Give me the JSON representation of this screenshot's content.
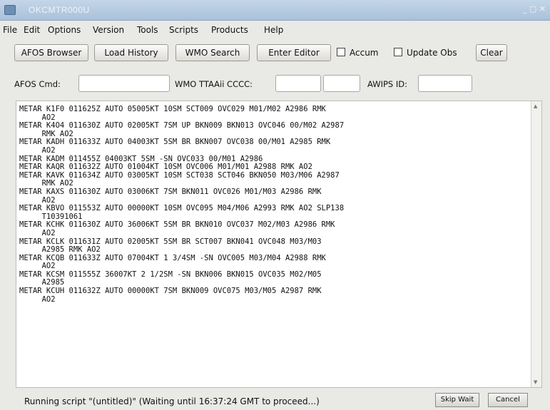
{
  "window": {
    "title": "OKCMTR000U",
    "controls": "_ ▢ ✕"
  },
  "menu": [
    "File",
    "Edit",
    "Options",
    "Version",
    "Tools",
    "Scripts",
    "Products",
    "Help"
  ],
  "toolbar": {
    "afos_browser": "AFOS Browser",
    "load_history": "Load History",
    "wmo_search": "WMO Search",
    "enter_editor": "Enter Editor",
    "accum": "Accum",
    "update_obs": "Update Obs",
    "clear": "Clear"
  },
  "query": {
    "afos_cmd_label": "AFOS Cmd:",
    "afos_cmd_value": "",
    "wmo_label": "WMO TTAAii CCCC:",
    "wmo_ttaaii_value": "",
    "wmo_cccc_value": "",
    "awips_label": "AWIPS ID:",
    "awips_value": ""
  },
  "reports": "METAR K1F0 011625Z AUTO 05005KT 10SM SCT009 OVC029 M01/M02 A2986 RMK\n     AO2\nMETAR K4O4 011630Z AUTO 02005KT 7SM UP BKN009 BKN013 OVC046 00/M02 A2987\n     RMK AO2\nMETAR KADH 011633Z AUTO 04003KT 5SM BR BKN007 OVC038 00/M01 A2985 RMK\n     AO2\nMETAR KADM 011455Z 04003KT 5SM -SN OVC033 00/M01 A2986\nMETAR KAQR 011632Z AUTO 01004KT 10SM OVC006 M01/M01 A2988 RMK AO2\nMETAR KAVK 011634Z AUTO 03005KT 10SM SCT038 SCT046 BKN050 M03/M06 A2987\n     RMK AO2\nMETAR KAXS 011630Z AUTO 03006KT 7SM BKN011 OVC026 M01/M03 A2986 RMK\n     AO2\nMETAR KBVO 011553Z AUTO 00000KT 10SM OVC095 M04/M06 A2993 RMK AO2 SLP138\n     T10391061\nMETAR KCHK 011630Z AUTO 36006KT 5SM BR BKN010 OVC037 M02/M03 A2986 RMK\n     AO2\nMETAR KCLK 011631Z AUTO 02005KT 5SM BR SCT007 BKN041 OVC048 M03/M03\n     A2985 RMK AO2\nMETAR KCQB 011633Z AUTO 07004KT 1 3/4SM -SN OVC005 M03/M04 A2988 RMK\n     AO2\nMETAR KCSM 011555Z 36007KT 2 1/2SM -SN BKN006 BKN015 OVC035 M02/M05\n     A2985\nMETAR KCUH 011632Z AUTO 00000KT 7SM BKN009 OVC075 M03/M05 A2987 RMK\n     AO2",
  "status": {
    "text": "Running script \"(untitled)\" (Waiting until 16:37:24 GMT to proceed...)",
    "skip_wait": "Skip Wait",
    "cancel": "Cancel"
  }
}
